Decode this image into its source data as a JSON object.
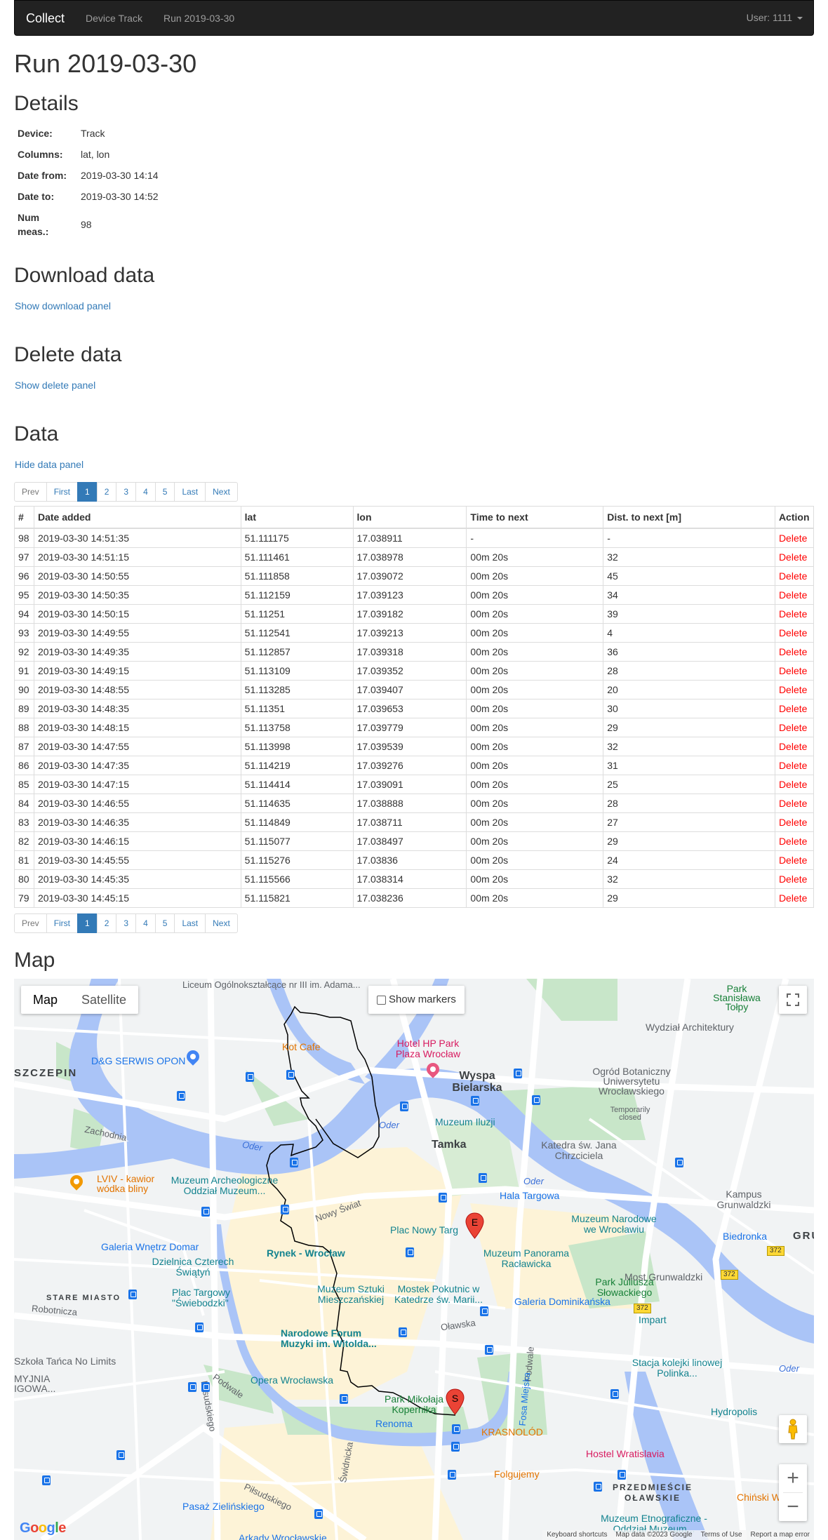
{
  "navbar": {
    "brand": "Collect",
    "links": [
      "Device Track",
      "Run 2019-03-30"
    ],
    "user": "User: 1111"
  },
  "page_title": "Run 2019-03-30",
  "details": {
    "heading": "Details",
    "rows": [
      {
        "label": "Device:",
        "value": "Track"
      },
      {
        "label": "Columns:",
        "value": "lat, lon"
      },
      {
        "label": "Date from:",
        "value": "2019-03-30 14:14"
      },
      {
        "label": "Date to:",
        "value": "2019-03-30 14:52"
      },
      {
        "label": "Num meas.:",
        "value": "98"
      }
    ]
  },
  "download": {
    "heading": "Download data",
    "link": "Show download panel"
  },
  "delete": {
    "heading": "Delete data",
    "link": "Show delete panel"
  },
  "data": {
    "heading": "Data",
    "link": "Hide data panel",
    "pagination": {
      "prev": "Prev",
      "first": "First",
      "pages": [
        "1",
        "2",
        "3",
        "4",
        "5"
      ],
      "active_page": "1",
      "last": "Last",
      "next": "Next"
    },
    "columns": [
      "#",
      "Date added",
      "lat",
      "lon",
      "Time to next",
      "Dist. to next [m]",
      "Action"
    ],
    "rows": [
      [
        "98",
        "2019-03-30 14:51:35",
        "51.111175",
        "17.038911",
        "-",
        "-",
        "Delete"
      ],
      [
        "97",
        "2019-03-30 14:51:15",
        "51.111461",
        "17.038978",
        "00m 20s",
        "32",
        "Delete"
      ],
      [
        "96",
        "2019-03-30 14:50:55",
        "51.111858",
        "17.039072",
        "00m 20s",
        "45",
        "Delete"
      ],
      [
        "95",
        "2019-03-30 14:50:35",
        "51.112159",
        "17.039123",
        "00m 20s",
        "34",
        "Delete"
      ],
      [
        "94",
        "2019-03-30 14:50:15",
        "51.11251",
        "17.039182",
        "00m 20s",
        "39",
        "Delete"
      ],
      [
        "93",
        "2019-03-30 14:49:55",
        "51.112541",
        "17.039213",
        "00m 20s",
        "4",
        "Delete"
      ],
      [
        "92",
        "2019-03-30 14:49:35",
        "51.112857",
        "17.039318",
        "00m 20s",
        "36",
        "Delete"
      ],
      [
        "91",
        "2019-03-30 14:49:15",
        "51.113109",
        "17.039352",
        "00m 20s",
        "28",
        "Delete"
      ],
      [
        "90",
        "2019-03-30 14:48:55",
        "51.113285",
        "17.039407",
        "00m 20s",
        "20",
        "Delete"
      ],
      [
        "89",
        "2019-03-30 14:48:35",
        "51.11351",
        "17.039653",
        "00m 20s",
        "30",
        "Delete"
      ],
      [
        "88",
        "2019-03-30 14:48:15",
        "51.113758",
        "17.039779",
        "00m 20s",
        "29",
        "Delete"
      ],
      [
        "87",
        "2019-03-30 14:47:55",
        "51.113998",
        "17.039539",
        "00m 20s",
        "32",
        "Delete"
      ],
      [
        "86",
        "2019-03-30 14:47:35",
        "51.114219",
        "17.039276",
        "00m 20s",
        "31",
        "Delete"
      ],
      [
        "85",
        "2019-03-30 14:47:15",
        "51.114414",
        "17.039091",
        "00m 20s",
        "25",
        "Delete"
      ],
      [
        "84",
        "2019-03-30 14:46:55",
        "51.114635",
        "17.038888",
        "00m 20s",
        "28",
        "Delete"
      ],
      [
        "83",
        "2019-03-30 14:46:35",
        "51.114849",
        "17.038711",
        "00m 20s",
        "27",
        "Delete"
      ],
      [
        "82",
        "2019-03-30 14:46:15",
        "51.115077",
        "17.038497",
        "00m 20s",
        "29",
        "Delete"
      ],
      [
        "81",
        "2019-03-30 14:45:55",
        "51.115276",
        "17.03836",
        "00m 20s",
        "24",
        "Delete"
      ],
      [
        "80",
        "2019-03-30 14:45:35",
        "51.115566",
        "17.038314",
        "00m 20s",
        "32",
        "Delete"
      ],
      [
        "79",
        "2019-03-30 14:45:15",
        "51.115821",
        "17.038236",
        "00m 20s",
        "29",
        "Delete"
      ]
    ],
    "delete_color": "#ff0000"
  },
  "map": {
    "heading": "Map",
    "type_control": {
      "map": "Map",
      "satellite": "Satellite",
      "selected": "Map"
    },
    "show_markers": {
      "label": "Show markers",
      "checked": false
    },
    "start_marker": "S",
    "end_marker": "E",
    "labels": {
      "liceum": "Liceum Ogólnokształcące nr III im. Adama...",
      "kot_cafe": "Kot Cafe",
      "hotel_hp": "Hotel HP Park Plaza Wrocław",
      "dg_serwis": "D&G SERWIS OPON",
      "szczepin": "SZCZEPIN",
      "zachodnia": "Zachodnia",
      "wyspa": "Wyspa Bielarska",
      "muzeum_iluzji": "Muzeum Iluzji",
      "tamka": "Tamka",
      "ogrod": "Ogród Botaniczny Uniwersytetu Wrocławskiego",
      "ogrod_closed": "Temporarily closed",
      "katedra": "Katedra św. Jana Chrzciciela",
      "wydzial": "Wydział Architektury",
      "park_tolpy": "Park Stanisława Tołpy",
      "lviv": "LVIV - kawior wódka bliny",
      "muzeum_arch": "Muzeum Archeologiczne Oddział Muzeum...",
      "nowy_swiat": "Nowy Świat",
      "hala": "Hala Targowa",
      "plac_nowy_targ": "Plac Nowy Targ",
      "kampus": "Kampus Grunwaldzki",
      "muzeum_narodowe": "Muzeum Narodowe we Wrocławiu",
      "biedronka": "Biedronka",
      "galeria_domar": "Galeria Wnętrz Domar",
      "rynek": "Rynek - Wrocław",
      "dzielnica": "Dzielnica Czterech Świątyń",
      "panorama": "Muzeum Panorama Racławicka",
      "stare_miasto": "STARE MIASTO",
      "plac_targowy": "Plac Targowy \"Świebodzki\"",
      "muzeum_sztuki": "Muzeum Sztuki Mieszczańskiej",
      "mostek": "Mostek Pokutnic w Katedrze św. Marii...",
      "park_slowackiego": "Park Juliusza Słowackiego",
      "galeria_dom": "Galeria Dominikańska",
      "most_grunwaldzki": "Most Grunwaldzki",
      "robotnicza": "Robotnicza",
      "impart": "Impart",
      "oder": "Oder",
      "forum": "Narodowe Forum Muzyki im. Witolda...",
      "szkola": "Szkoła Tańca No Limits",
      "myjnia": "MYJNIA IGOWA...",
      "opera": "Opera Wrocławska",
      "stacja": "Stacja kolejki linowej Polinka...",
      "park_kopernika": "Park Mikołaja Kopernika",
      "renoma": "Renoma",
      "krasnolod": "KRASNOLÓD",
      "hydropolis": "Hydropolis",
      "hostel": "Hostel Wratislavia",
      "folgujemy": "Folgujemy",
      "przedmiescie": "PRZEDMIEŚCIE OŁAWSKIE",
      "chinski": "Chiński Wiatr",
      "pasaz": "Pasaż Zielińskiego",
      "muzeum_etno": "Muzeum Etnograficzne - Oddział Muzeum...",
      "arkady": "Arkady Wrocławskie",
      "olawska": "Oławska",
      "pilsudskiego": "Piłsudskiego",
      "swidnicka": "Świdnicka",
      "podwale": "Podwale",
      "fosa": "Fosa Miejska",
      "route_372": "372"
    },
    "attribution": {
      "logo": "Google",
      "keyboard": "Keyboard shortcuts",
      "map_data": "Map data ©2023 Google",
      "terms": "Terms of Use",
      "report": "Report a map error"
    }
  }
}
